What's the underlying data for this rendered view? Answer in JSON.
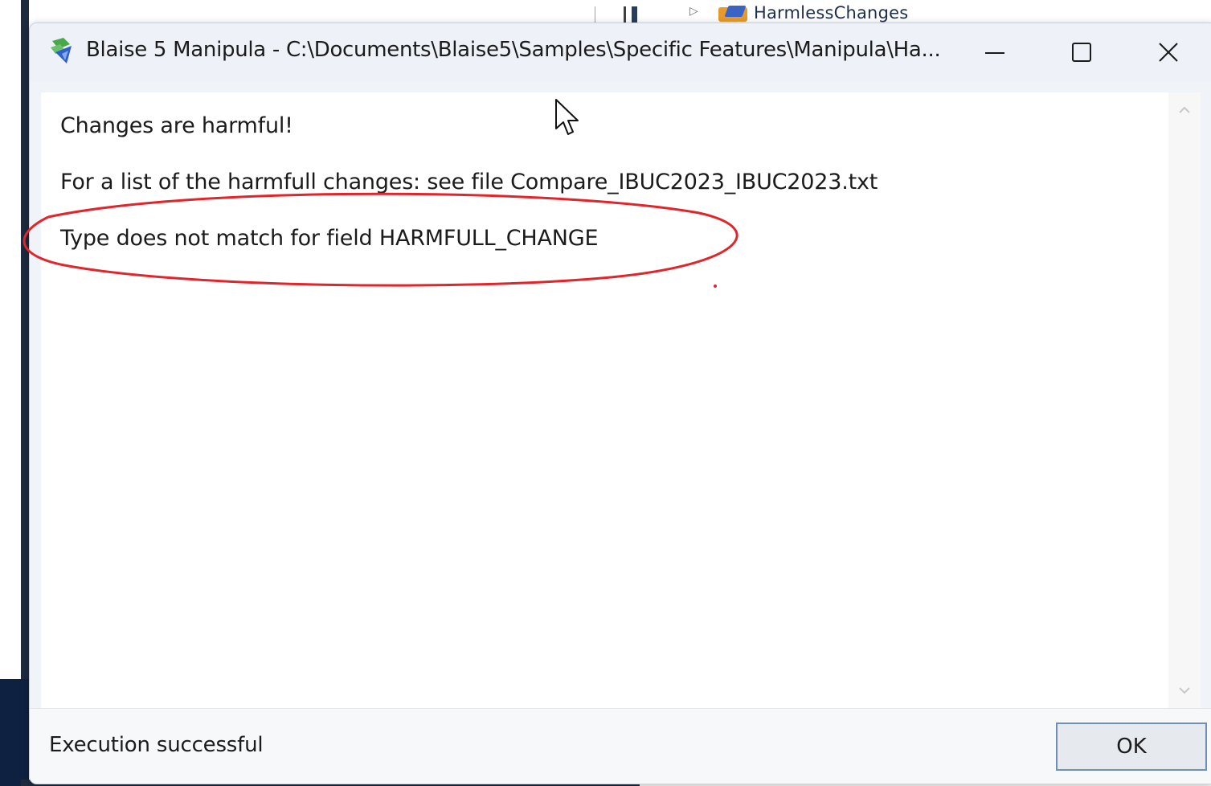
{
  "background": {
    "tree_item_label": "HarmlessChanges"
  },
  "window": {
    "title": "Blaise 5 Manipula - C:\\Documents\\Blaise5\\Samples\\Specific Features\\Manipula\\Ha...",
    "controls": {
      "minimize_icon": "minimize-icon",
      "maximize_icon": "maximize-icon",
      "close_icon": "close-icon"
    }
  },
  "messages": [
    "Changes are harmful!",
    "For a list of the harmfull changes: see file Compare_IBUC2023_IBUC2023.txt",
    "Type does not match for field HARMFULL_CHANGE"
  ],
  "footer": {
    "status": "Execution successful",
    "ok_label": "OK"
  },
  "colors": {
    "annotation": "#e0262b",
    "ok_border": "#6f8fb5"
  }
}
